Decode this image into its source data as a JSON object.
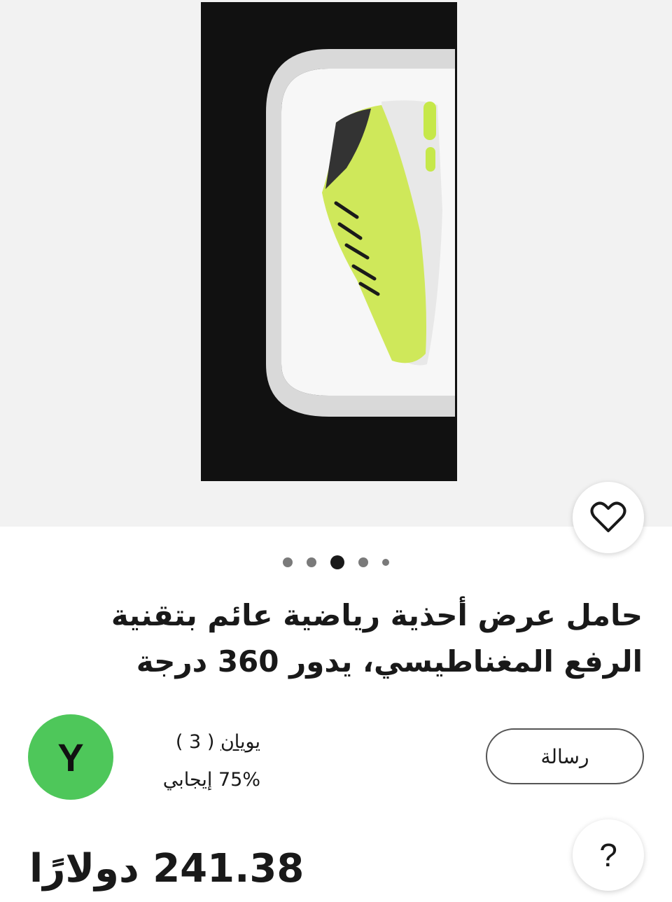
{
  "product": {
    "title": "حامل عرض أحذية رياضية عائم بتقنية الرفع المغناطيسي، يدور 360 درجة",
    "price": "241.38 دولارًا",
    "image_count": 5,
    "active_image_index": 2
  },
  "seller": {
    "avatar_letter": "Y",
    "name": "يويان",
    "rating_count": "( 3 )",
    "feedback": "75% إيجابي",
    "avatar_color": "#4ec75a"
  },
  "actions": {
    "message_label": "رسالة",
    "help_label": "?"
  },
  "icons": {
    "favorite": "heart-icon"
  }
}
